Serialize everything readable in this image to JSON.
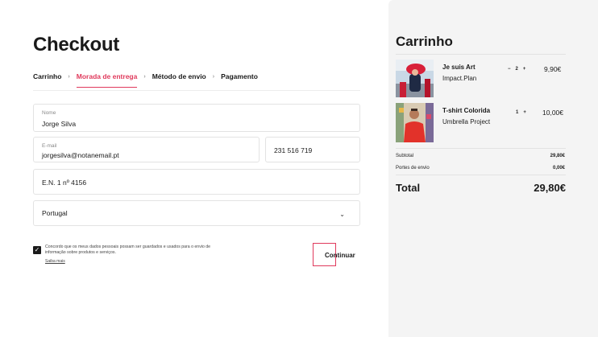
{
  "checkout": {
    "title": "Checkout",
    "steps": [
      "Carrinho",
      "Morada de entrega",
      "Método de envio",
      "Pagamento"
    ],
    "active_step": 1
  },
  "form": {
    "name": {
      "label": "Nome",
      "value": "Jorge Silva"
    },
    "email": {
      "label": "E-mail",
      "value": "jorgesilva@notanemail.pt"
    },
    "phone": {
      "value": "231 516 719"
    },
    "address": {
      "value": "E.N. 1 nº 4156"
    },
    "country": {
      "value": "Portugal"
    }
  },
  "consent": {
    "checked": true,
    "text": "Concordo que os meus dados pessoais possam ser guardados e usados para o envio de informação sobre produtos e serviços.",
    "learn_more": "Saiba mais"
  },
  "continue_label": "Continuar",
  "cart": {
    "title": "Carrinho",
    "items": [
      {
        "name": "Je suis Art",
        "brand": "Impact.Plan",
        "minus": "−",
        "qty": "2",
        "plus": "+",
        "price": "9,90€"
      },
      {
        "name": "T-shirt Colorida",
        "brand": "Umbrella Project",
        "qty": "1",
        "plus": "+",
        "price": "10,00€"
      }
    ],
    "subtotal_label": "Subtotal",
    "subtotal_value": "29,80€",
    "shipping_label": "Portes de envio",
    "shipping_value": "0,00€",
    "total_label": "Total",
    "total_value": "29,80€"
  },
  "colors": {
    "accent": "#e03a5c",
    "panel": "#f4f4f4"
  }
}
